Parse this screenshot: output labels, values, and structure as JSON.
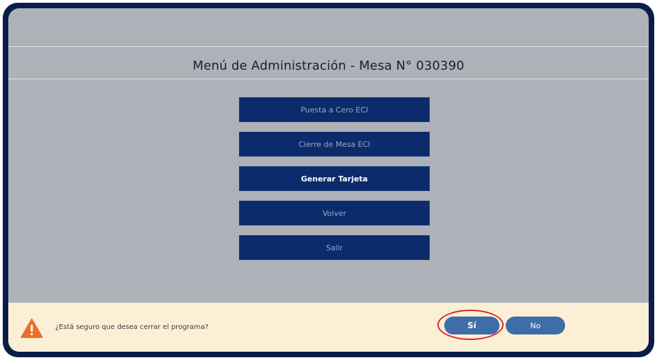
{
  "header": {
    "title": "Menú de Administración - Mesa N° 030390"
  },
  "menu": {
    "items": [
      {
        "label": "Puesta a Cero ECI"
      },
      {
        "label": "Cierre de Mesa ECI"
      },
      {
        "label": "Generar Tarjeta"
      },
      {
        "label": "Volver"
      },
      {
        "label": "Salir"
      }
    ]
  },
  "confirm": {
    "message": "¿Está seguro que desea cerrar el programa?",
    "yes_label": "Sí",
    "no_label": "No"
  },
  "colors": {
    "frame": "#0b1c47",
    "screen_bg": "#aeb1b8",
    "menu_button": "#0c2b6b",
    "confirm_bg": "#fbf0d5",
    "pill_button": "#3e6da8",
    "warning_icon": "#e8702a",
    "highlight": "#e0262a"
  },
  "icons": {
    "warning": "warning-triangle-icon"
  }
}
